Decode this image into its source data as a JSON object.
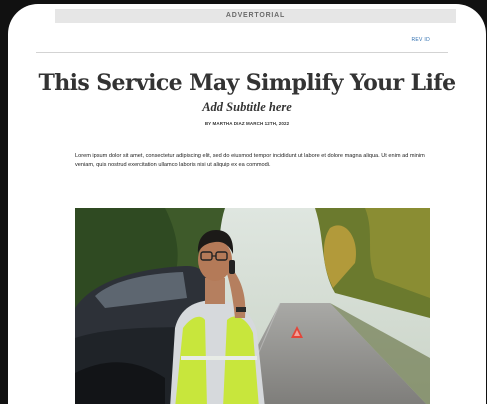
{
  "banner": {
    "label": "ADVERTORIAL"
  },
  "header": {
    "link_label": "REV ID"
  },
  "article": {
    "title": "This Service May Simplify Your Life",
    "subtitle": "Add Subtitle here",
    "byline": "BY MARTHA DIAZ MARCH 12TH, 2022",
    "body": "Lorem ipsum dolor sit amet, consectetur adipiscing elit, sed do eiusmod tempor incididunt ut labore et dolore magna aliqua. Ut enim ad minim veniam, quis nostrud exercitation ullamco laboris nisi ut aliquip ex ea commodi."
  },
  "colors": {
    "background": "#111111",
    "page": "#ffffff",
    "banner_bg": "#e6e6e6",
    "banner_text": "#6b6b6b",
    "link": "#2f6fb0",
    "title_text": "#333333",
    "safety_vest": "#c8e63c"
  },
  "image": {
    "subject": "man-on-phone-roadside-photo"
  }
}
